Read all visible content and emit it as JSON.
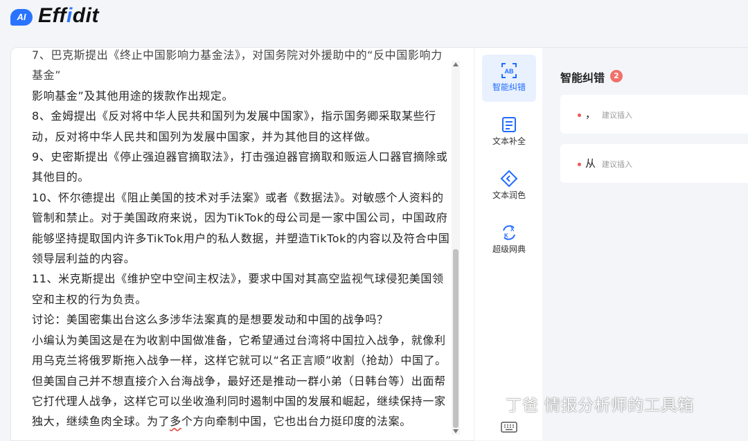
{
  "app": {
    "logo_badge": "AI",
    "logo_text_prefix": "Eff",
    "logo_text_accent": "i",
    "logo_text_suffix": "dit"
  },
  "editor": {
    "top_cut_line": "7、巴克斯提出《终止中国影响力基金法》，对国务院对外援助中的“反中国影响力基金”",
    "paragraphs": [
      "影响基金”及其他用途的拨款作出规定。",
      "8、金姆提出《反对将中华人民共和国列为发展中国家》，指示国务卿采取某些行动，反对将中华人民共和国列为发展中国家，并为其他目的这样做。",
      "9、史密斯提出《停止强迫器官摘取法》，打击强迫器官摘取和贩运人口器官摘除或其他目的。",
      "10、怀尔德提出《阻止美国的技术对手法案》或者《数据法》。对敏感个人资料的管制和禁止。对于美国政府来说，因为TikTok的母公司是一家中国公司，中国政府能够坚持提取国内许多TikTok用户的私人数据，并塑造TikTok的内容以及符合中国领导层利益的内容。",
      "11、米克斯提出《维护空中空间主权法》，要求中国对其高空监视气球侵犯美国领空和主权的行为负责。",
      "讨论：美国密集出台这么多涉华法案真的是想要发动和中国的战争吗？"
    ],
    "last_paragraph_before": "小编认为美国这是在为收割中国做准备，它希望通过台湾将中国拉入战争，就像利用乌克兰将俄罗斯拖入战争一样，这样它就可以“名正言顺”收割（抢劫）中国了。但美国自己并不想直接介入台海战争，最好还是推动一群小弟（日韩台等）出面帮它打代理人战争，这样它可以坐收渔利同时遏制中国的发展和崛起，继续保持一家独大，继续鱼肉全球。为了",
    "last_paragraph_flagged": "多",
    "last_paragraph_after": "个方向牵制中国，它也出台力挺印度的法案。"
  },
  "tools": [
    {
      "label": "智能纠错",
      "icon": "ai-correction-icon",
      "active": true
    },
    {
      "label": "文本补全",
      "icon": "text-completion-icon",
      "active": false
    },
    {
      "label": "文本润色",
      "icon": "text-polish-icon",
      "active": false
    },
    {
      "label": "超级网典",
      "icon": "super-dictionary-icon",
      "active": false
    }
  ],
  "panel": {
    "title": "智能纠错",
    "count": "2",
    "suggestions": [
      {
        "word": "，",
        "hint": "建议插入"
      },
      {
        "word": "从",
        "hint": "建议插入"
      }
    ]
  },
  "watermark": {
    "text": "丁爸 情报分析师的工具箱"
  },
  "colors": {
    "accent": "#2a73ff",
    "badge_red": "#f2706a",
    "error_dot": "#f25555"
  }
}
